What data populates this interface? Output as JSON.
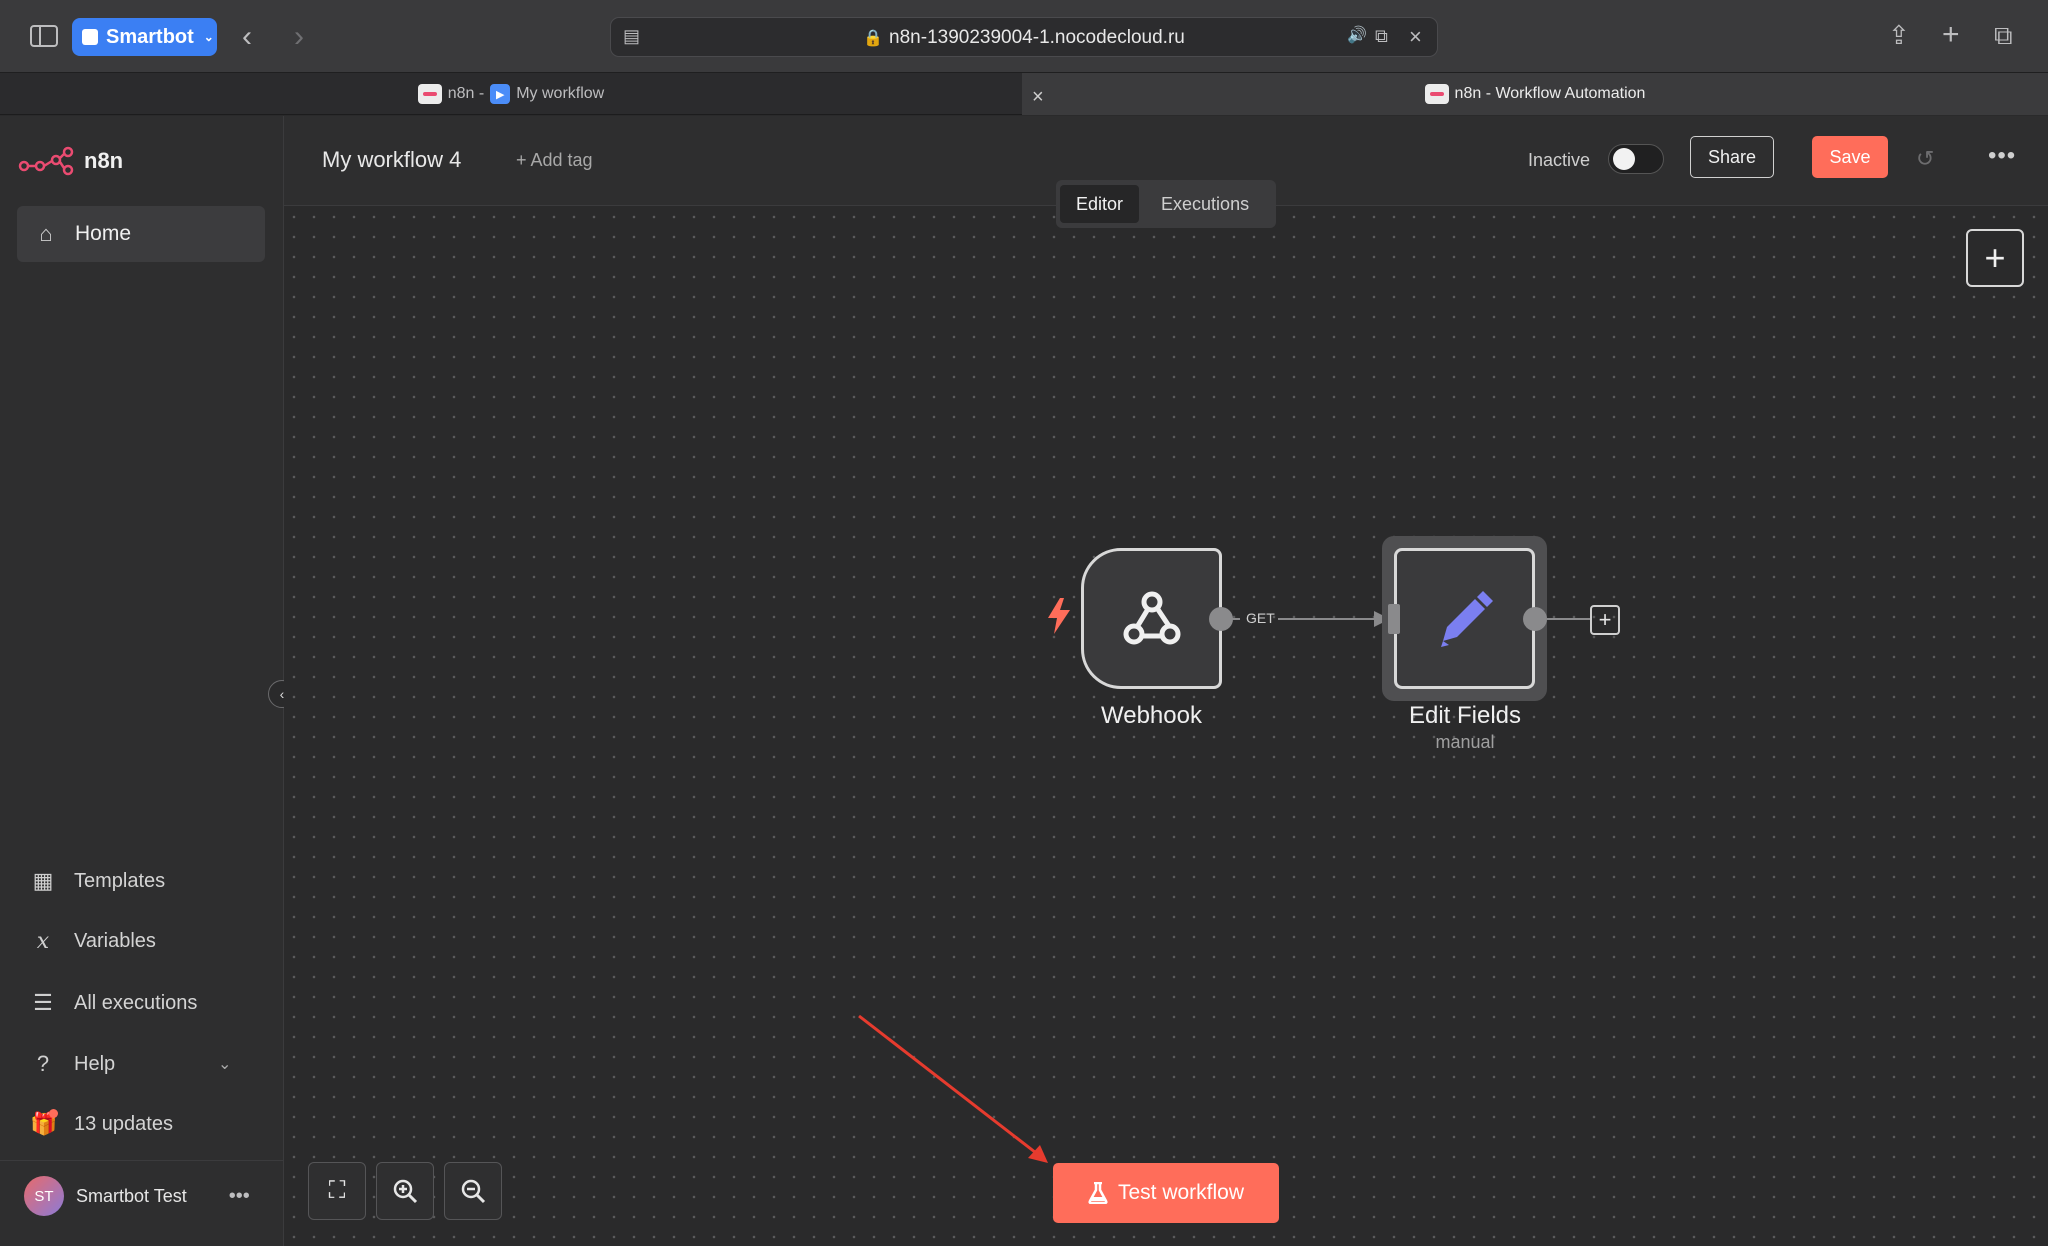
{
  "browser": {
    "profile_label": "Smartbot",
    "url": "n8n-1390239004-1.nocodecloud.ru",
    "tabs": [
      {
        "prefix": "n8n -",
        "label": "My workflow"
      },
      {
        "label": "n8n - Workflow Automation"
      }
    ]
  },
  "app": {
    "logo_text": "n8n",
    "sidebar": {
      "home": "Home",
      "items": [
        "Templates",
        "Variables",
        "All executions",
        "Help",
        "13 updates"
      ],
      "user_name": "Smartbot Test",
      "user_initials": "ST"
    },
    "header": {
      "workflow_name": "My workflow 4",
      "add_tag": "+ Add tag",
      "status": "Inactive",
      "share": "Share",
      "save": "Save"
    },
    "tabs": {
      "editor": "Editor",
      "executions": "Executions"
    },
    "nodes": {
      "webhook": {
        "label": "Webhook"
      },
      "edit_fields": {
        "label": "Edit Fields",
        "subtitle": "manual"
      },
      "connection_label": "GET"
    },
    "test_button": "Test workflow",
    "colors": {
      "accent": "#ff6d5a",
      "brand": "#ea4b71",
      "edit_icon": "#7b7ff0"
    }
  }
}
